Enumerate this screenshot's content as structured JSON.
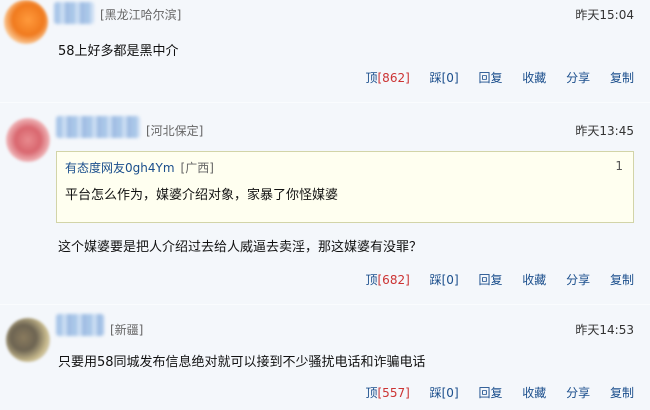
{
  "comments": [
    {
      "location": "[黑龙江哈尔滨]",
      "time": "昨天15:04",
      "content": "58上好多都是黑中介",
      "actions": {
        "up_label": "顶",
        "up_count": "[862]",
        "down_label": "踩",
        "down_count": "[0]",
        "reply": "回复",
        "save": "收藏",
        "share": "分享",
        "copy": "复制"
      }
    },
    {
      "location": "[河北保定]",
      "time": "昨天13:45",
      "quote": {
        "user": "有态度网友0gh4Ym",
        "location": "[广西]",
        "floor": "1",
        "text": "平台怎么作为，媒婆介绍对象，家暴了你怪媒婆"
      },
      "content": "这个媒婆要是把人介绍过去给人威逼去卖淫，那这媒婆有没罪？",
      "actions": {
        "up_label": "顶",
        "up_count": "[682]",
        "down_label": "踩",
        "down_count": "[0]",
        "reply": "回复",
        "save": "收藏",
        "share": "分享",
        "copy": "复制"
      }
    },
    {
      "location": "[新疆]",
      "time": "昨天14:53",
      "content": "只要用58同城发布信息绝对就可以接到不少骚扰电话和诈骗电话",
      "actions": {
        "up_label": "顶",
        "up_count": "[557]",
        "down_label": "踩",
        "down_count": "[0]",
        "reply": "回复",
        "save": "收藏",
        "share": "分享",
        "copy": "复制"
      }
    }
  ]
}
